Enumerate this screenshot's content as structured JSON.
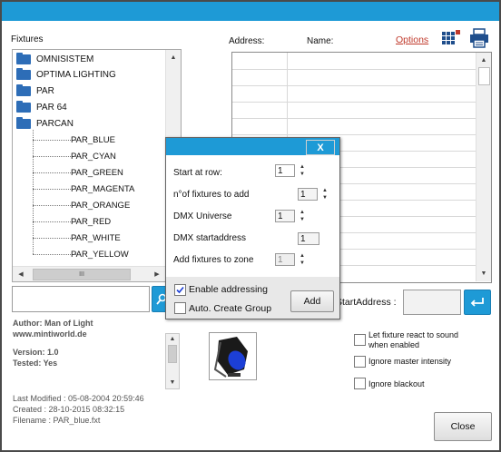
{
  "window": {
    "accent": "#1e9ad6"
  },
  "left": {
    "fixtures_label": "Fixtures",
    "folders": [
      "OMNISISTEM",
      "OPTIMA LIGHTING",
      "PAR",
      "PAR 64",
      "PARCAN"
    ],
    "children": [
      "PAR_BLUE",
      "PAR_CYAN",
      "PAR_GREEN",
      "PAR_MAGENTA",
      "PAR_ORANGE",
      "PAR_RED",
      "PAR_WHITE",
      "PAR_YELLOW"
    ],
    "scroll_grip": "III",
    "search_value": "",
    "author": "Author: Man of Light",
    "website": "www.mintiworld.de",
    "version": "Version: 1.0",
    "tested": "Tested: Yes",
    "last_modified": "Last Modified : 05-08-2004 20:59:46",
    "created": "Created : 28-10-2015 08:32:15",
    "filename": "Filename : PAR_blue.fxt"
  },
  "header": {
    "address_label": "Address:",
    "name_label": "Name:",
    "options_link": "Options"
  },
  "grid": {
    "rows": 13
  },
  "start_address": {
    "label": "StartAddress :",
    "value": ""
  },
  "options": {
    "react_sound": "Let fixture react to sound when enabled",
    "ignore_master": "Ignore master intensity",
    "ignore_blackout": "Ignore blackout"
  },
  "close_label": "Close",
  "dialog": {
    "close_glyph": "X",
    "start_row_label": "Start at row:",
    "start_row_value": "1",
    "num_fixtures_label": "n°of fixtures to add",
    "num_fixtures_value": "1",
    "dmx_universe_label": "DMX Universe",
    "dmx_universe_value": "1",
    "dmx_start_label": "DMX startaddress",
    "dmx_start_value": "1",
    "zone_label": "Add fixtures to zone",
    "zone_value": "1",
    "enable_addressing_label": "Enable addressing",
    "enable_addressing_checked": true,
    "auto_group_label": "Auto. Create Group",
    "auto_group_checked": false,
    "add_label": "Add"
  }
}
